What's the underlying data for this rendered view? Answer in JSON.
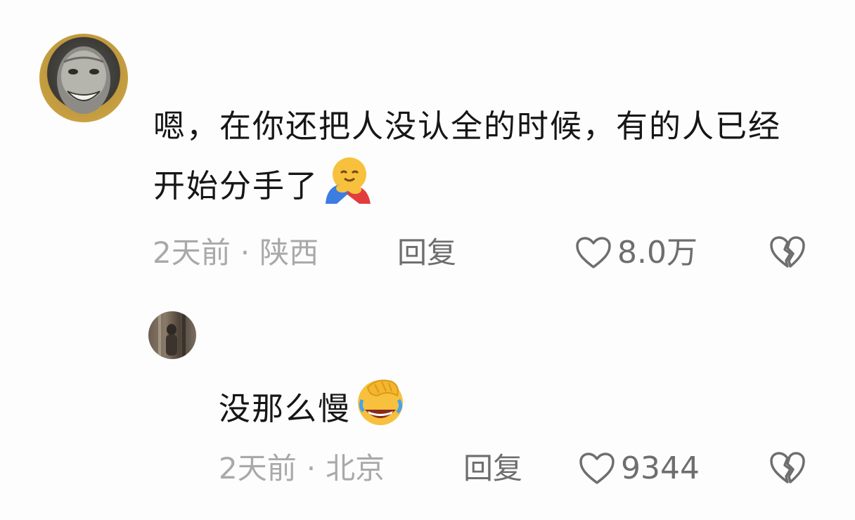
{
  "comments": [
    {
      "text": "嗯，在你还把人没认全的时候，有的人已经开始分手了",
      "emoji": "hugging-face-emoji",
      "time": "2天前",
      "location": "陕西",
      "reply_label": "回复",
      "likes": "8.0万"
    },
    {
      "text": "没那么慢",
      "emoji": "laughing-covering-face-emoji",
      "time": "2天前",
      "location": "北京",
      "reply_label": "回复",
      "likes": "9344"
    }
  ],
  "meta_separator": "·",
  "colors": {
    "text": "#161616",
    "meta": "#a9a9a9",
    "action": "#6e6e6e",
    "background": "#fdfdfd"
  }
}
